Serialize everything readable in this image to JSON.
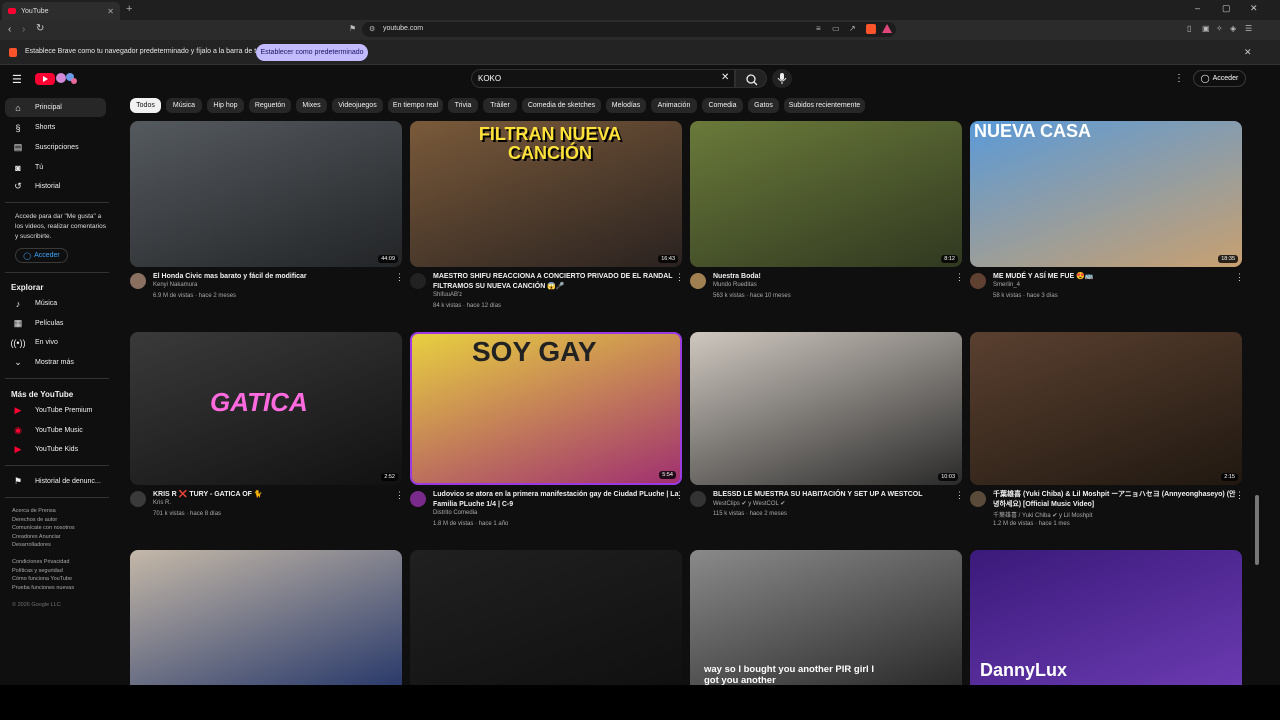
{
  "browser": {
    "tab_title": "YouTube",
    "new_tab": "+",
    "url": "youtube.com",
    "infobar_text": "Establece Brave como tu navegador predeterminado y fíjalo a la barra de tareas",
    "infobar_button": "Establecer como predeterminado",
    "close": "✕",
    "min": "–",
    "max": "▢"
  },
  "header": {
    "search_value": "KOKO",
    "clear": "✕",
    "signin_label": "Acceder",
    "kebab": "⋮",
    "menu": "☰"
  },
  "chips": [
    "Todos",
    "Música",
    "Hip hop",
    "Reguetón",
    "Mixes",
    "Videojuegos",
    "En tiempo real",
    "Trivia",
    "Tráiler",
    "Comedia de sketches",
    "Melodías",
    "Animación",
    "Comedia",
    "Gatos",
    "Subidos recientemente"
  ],
  "sidebar": {
    "main": [
      "Principal",
      "Shorts",
      "Suscripciones",
      "Tú",
      "Historial"
    ],
    "signin_msg": "Accede para dar \"Me gusta\" a los videos, realizar comentarios y suscribirte.",
    "signin_btn": "Acceder",
    "explore_title": "Explorar",
    "explore": [
      "Música",
      "Películas",
      "En vivo",
      "Mostrar más"
    ],
    "more_title": "Más de YouTube",
    "more": [
      "YouTube Premium",
      "YouTube Music",
      "YouTube Kids"
    ],
    "report": "Historial de denunc...",
    "footer1": [
      "Acerca de  Prensa",
      "Derechos de autor",
      "Comunícate con nosotros",
      "Creadores  Anunciar",
      "Desarrolladores"
    ],
    "footer2": [
      "Condiciones  Privacidad",
      "Políticas y seguridad",
      "Cómo funciona YouTube",
      "Prueba funciones nuevas"
    ],
    "copyright": "© 2026 Google LLC"
  },
  "videos": [
    {
      "title": "El Honda Civic mas barato y fácil de modificar",
      "channel": "Kenyi Nakamura",
      "meta": "6.9 M de vistas · hace 2 meses",
      "duration": "44:09",
      "thumb_text": "",
      "colors": [
        "#555a5f",
        "#222426"
      ],
      "avatar_color": "#8a7060"
    },
    {
      "title": "MAESTRO SHIFU REACCIONA A CONCIERTO PRIVADO DE EL RANDAL FILTRAMOS SU NUEVA CANCIÓN 😱🎤",
      "channel": "ShifuuAB'z",
      "meta": "84 k vistas · hace 12 días",
      "duration": "16:43",
      "thumb_text": "FILTRAN NUEVA CANCIÓN",
      "colors": [
        "#7a5a3a",
        "#2a2220"
      ],
      "avatar_color": "#222222"
    },
    {
      "title": "Nuestra Boda!",
      "channel": "Mundo Rueditas",
      "meta": "563 k vistas · hace 10 meses",
      "duration": "8:12",
      "thumb_text": "",
      "colors": [
        "#6a7a3a",
        "#303820"
      ],
      "avatar_color": "#a08050"
    },
    {
      "title": "ME MUDÉ Y ASÍ ME FUE 😍🚌",
      "channel": "Smerlin_4",
      "meta": "58 k vistas · hace 3 días",
      "duration": "18:35",
      "thumb_text": "NUEVA CASA",
      "colors": [
        "#5a9ad8",
        "#c8a070"
      ],
      "avatar_color": "#604030"
    },
    {
      "title": "KRIS R ❌ TURY - GATICA OF 🐈",
      "channel": "Kris R.",
      "meta": "701 k vistas · hace 8 días",
      "duration": "2:52",
      "thumb_text": "GATICA",
      "colors": [
        "#3a3a3a",
        "#111111"
      ],
      "avatar_color": "#3a3a3a"
    },
    {
      "title": "Ludovico se atora en la primera manifestación gay de Ciudad PLuche | La Familia PLuche 1/4 | C-9",
      "channel": "Distrito Comedia",
      "meta": "1.8 M de vistas · hace 1 año",
      "duration": "5:54",
      "thumb_text": "SOY GAY",
      "colors": [
        "#e8d040",
        "#a03070"
      ],
      "avatar_color": "#7a2a8a"
    },
    {
      "title": "BLESSD LE MUESTRA SU HABITACIÓN Y SET UP A WESTCOL",
      "channel": "WestClips ✔ y WestCOL ✔",
      "meta": "115 k vistas · hace 2 meses",
      "duration": "10:03",
      "thumb_text": "",
      "colors": [
        "#cfc8c0",
        "#2a2a2a"
      ],
      "avatar_color": "#333333"
    },
    {
      "title": "千葉雄喜 (Yuki Chiba) & Lil Moshpit ーアニョハセヨ (Annyeonghaseyo) (안녕하세요) [Official Music Video]",
      "channel": "千葉雄喜 / Yuki Chiba ✔ y Lil Moshpit",
      "meta": "1.2 M de vistas · hace 1 mes",
      "duration": "2:15",
      "thumb_text": "",
      "colors": [
        "#5a4030",
        "#201810"
      ],
      "avatar_color": "#5a4a3a"
    },
    {
      "title": "",
      "channel": "",
      "meta": "",
      "duration": "",
      "thumb_text": "",
      "colors": [
        "#c4b8a8",
        "#2a3a6a"
      ],
      "avatar_color": "#000000"
    },
    {
      "title": "",
      "channel": "",
      "meta": "",
      "duration": "",
      "thumb_text": "",
      "colors": [
        "#202020",
        "#101010"
      ],
      "avatar_color": "#000000"
    },
    {
      "title": "",
      "channel": "",
      "meta": "",
      "duration": "",
      "thumb_text": "way so I bought you another PIR girl I got you another",
      "colors": [
        "#8a8a8a",
        "#2a2a2a"
      ],
      "avatar_color": "#000000"
    },
    {
      "title": "",
      "channel": "",
      "meta": "",
      "duration": "",
      "thumb_text": "DannyLux",
      "colors": [
        "#3a1a7a",
        "#6a3ab0"
      ],
      "avatar_color": "#000000"
    }
  ]
}
